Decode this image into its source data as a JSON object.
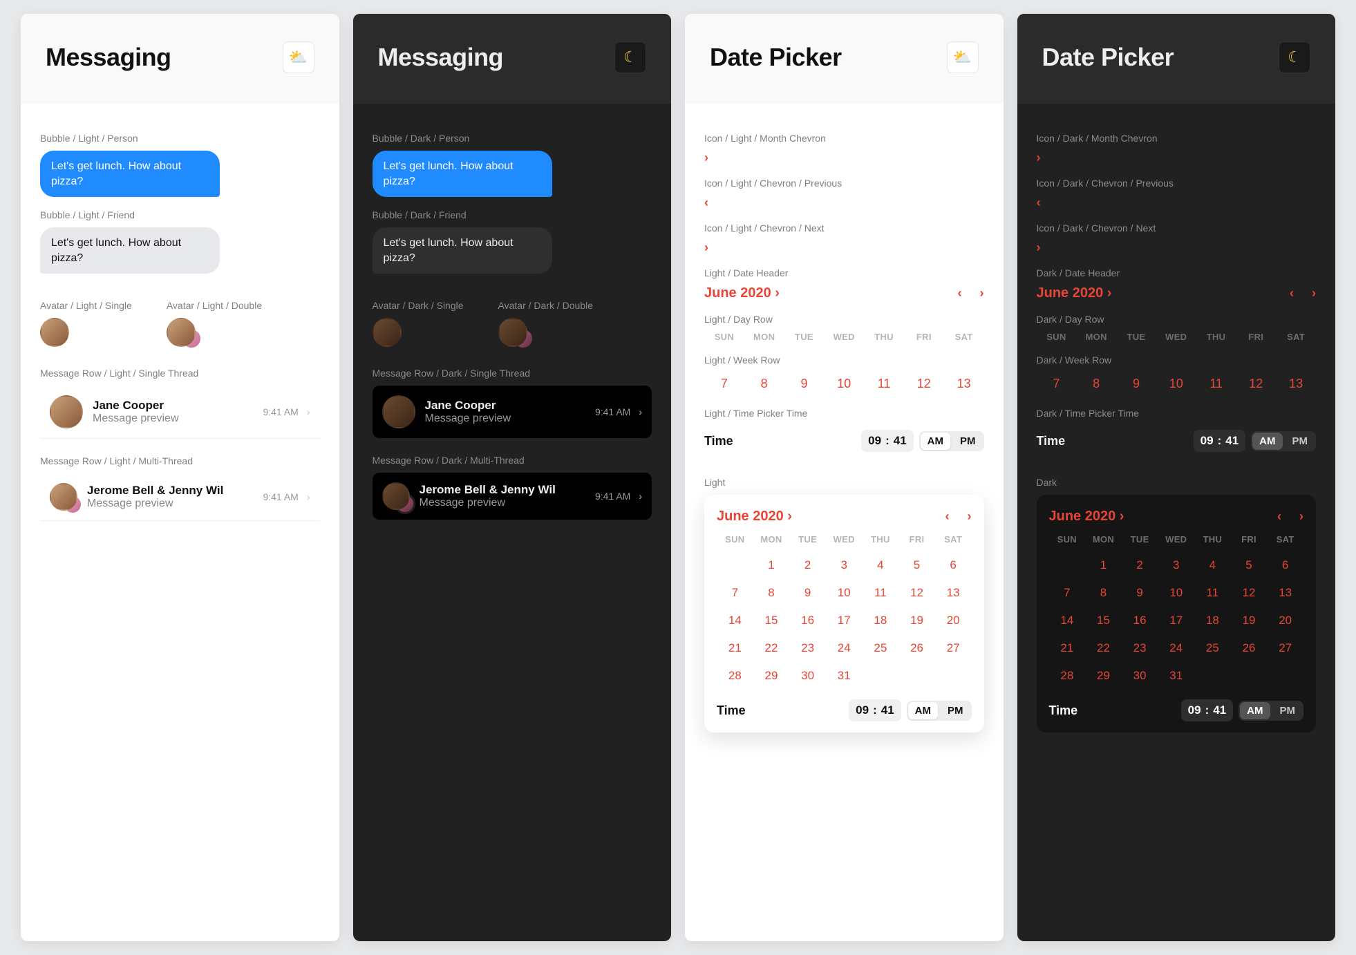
{
  "messaging": {
    "title": "Messaging",
    "labels": {
      "bubble_person_light": "Bubble / Light / Person",
      "bubble_person_dark": "Bubble / Dark / Person",
      "bubble_friend_light": "Bubble / Light / Friend",
      "bubble_friend_dark": "Bubble / Dark / Friend",
      "avatar_single_light": "Avatar / Light / Single",
      "avatar_double_light": "Avatar / Light / Double",
      "avatar_single_dark": "Avatar / Dark / Single",
      "avatar_double_dark": "Avatar / Dark / Double",
      "row_single_light": "Message Row / Light / Single Thread",
      "row_single_dark": "Message Row / Dark / Single Thread",
      "row_multi_light": "Message Row / Light / Multi-Thread",
      "row_multi_dark": "Message Row / Dark / Multi-Thread"
    },
    "bubble_text": "Let's get lunch. How about pizza?",
    "row_single": {
      "name": "Jane Cooper",
      "preview": "Message preview",
      "time": "9:41 AM"
    },
    "row_multi": {
      "name": "Jerome Bell & Jenny Wil",
      "preview": "Message preview",
      "time": "9:41 AM"
    }
  },
  "datepicker": {
    "title": "Date Picker",
    "labels": {
      "chev_month_light": "Icon / Light / Month Chevron",
      "chev_month_dark": "Icon / Dark / Month Chevron",
      "chev_prev_light": "Icon / Light / Chevron / Previous",
      "chev_prev_dark": "Icon / Dark / Chevron / Previous",
      "chev_next_light": "Icon / Light / Chevron / Next",
      "chev_next_dark": "Icon / Dark / Chevron / Next",
      "date_header_light": "Light / Date Header",
      "date_header_dark": "Dark / Date Header",
      "day_row_light": "Light / Day Row",
      "day_row_dark": "Dark / Day Row",
      "week_row_light": "Light / Week Row",
      "week_row_dark": "Dark / Week Row",
      "time_picker_light": "Light / Time Picker Time",
      "time_picker_dark": "Dark / Time Picker Time",
      "calendar_light": "Light",
      "calendar_dark": "Dark"
    },
    "month_label": "June 2020",
    "days": [
      "SUN",
      "MON",
      "TUE",
      "WED",
      "THU",
      "FRI",
      "SAT"
    ],
    "week_row": [
      "7",
      "8",
      "9",
      "10",
      "11",
      "12",
      "13"
    ],
    "time_label": "Time",
    "time_hour": "09",
    "time_min": "41",
    "ampm": {
      "am": "AM",
      "pm": "PM"
    },
    "calendar": {
      "start_blank": 1,
      "days_in_month": 31
    }
  }
}
